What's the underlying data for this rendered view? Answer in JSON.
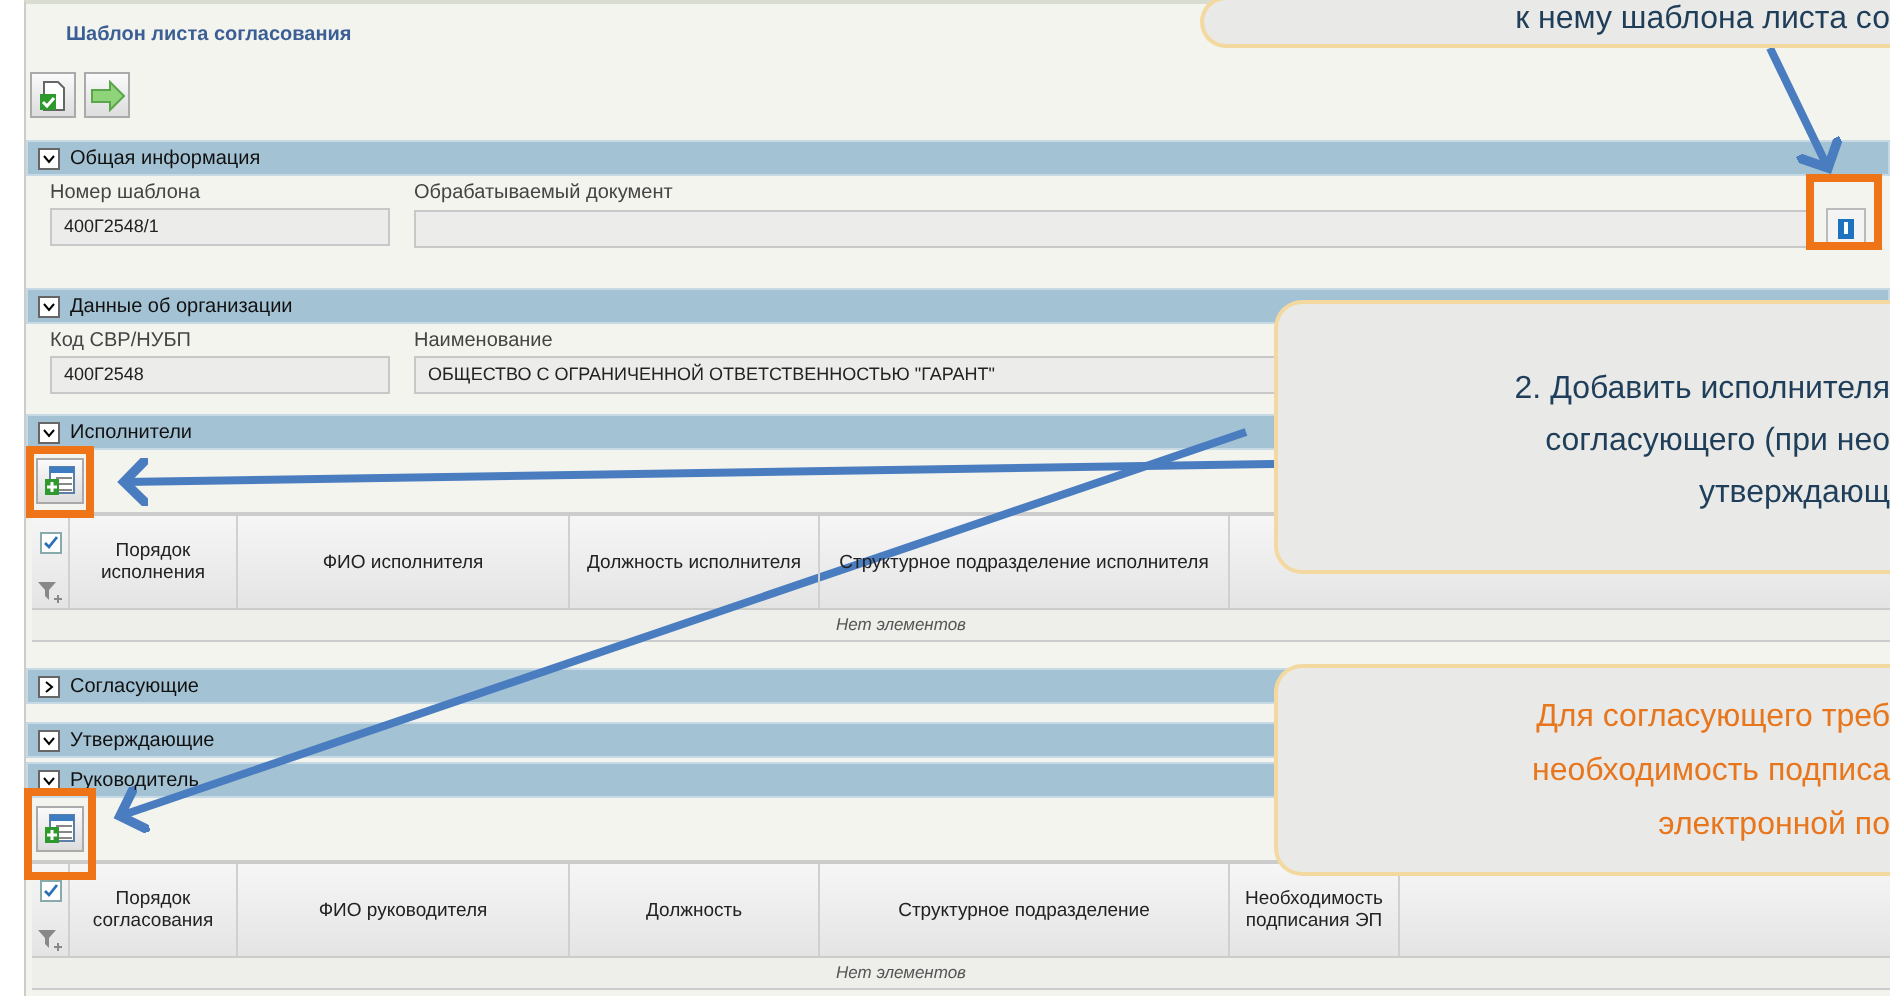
{
  "title": "Шаблон листа согласования",
  "sections": [
    {
      "title": "Общая информация",
      "expanded": true,
      "kind": "fields",
      "fields": [
        {
          "label": "Номер шаблона",
          "value": "400Г2548/1",
          "kind": "text"
        },
        {
          "label": "Обрабатываемый документ",
          "kind": "lookup"
        }
      ]
    },
    {
      "title": "Данные об организации",
      "expanded": true,
      "kind": "fields",
      "fields": [
        {
          "label": "Код СВР/НУБП",
          "value": "400Г2548",
          "kind": "text"
        },
        {
          "label": "Наименование",
          "value": "ОБЩЕСТВО С ОГРАНИЧЕННОЙ ОТВЕТСТВЕННОСТЬЮ \"ГАРАНТ\"",
          "kind": "text"
        }
      ]
    },
    {
      "title": "Исполнители",
      "expanded": true,
      "kind": "grid",
      "select_all_checked": true,
      "columns": [
        "Порядок исполнения",
        "ФИО исполнителя",
        "Должность исполнителя",
        "Структурное подразделение исполнителя"
      ],
      "empty": "Нет элементов"
    },
    {
      "title": "Согласующие",
      "expanded": false,
      "kind": "header"
    },
    {
      "title": "Утверждающие",
      "expanded": true,
      "kind": "header"
    },
    {
      "title": "Руководитель",
      "expanded": true,
      "kind": "grid",
      "select_all_checked": true,
      "columns": [
        "Порядок согласования",
        "ФИО руководителя",
        "Должность",
        "Структурное подразделение",
        "Необходимость подписания ЭП"
      ],
      "empty": "Нет элементов"
    }
  ],
  "callouts": [
    {
      "lines": [
        "к нему шаблона листа со"
      ],
      "kind": "note"
    },
    {
      "lines": [
        "2. Добавить исполнителя",
        "согласующего (при нео",
        "утверждающ"
      ],
      "kind": "note"
    },
    {
      "lines": [
        "Для согласующего треб",
        "необходимость подписа",
        "электронной по"
      ],
      "kind": "warning"
    }
  ]
}
